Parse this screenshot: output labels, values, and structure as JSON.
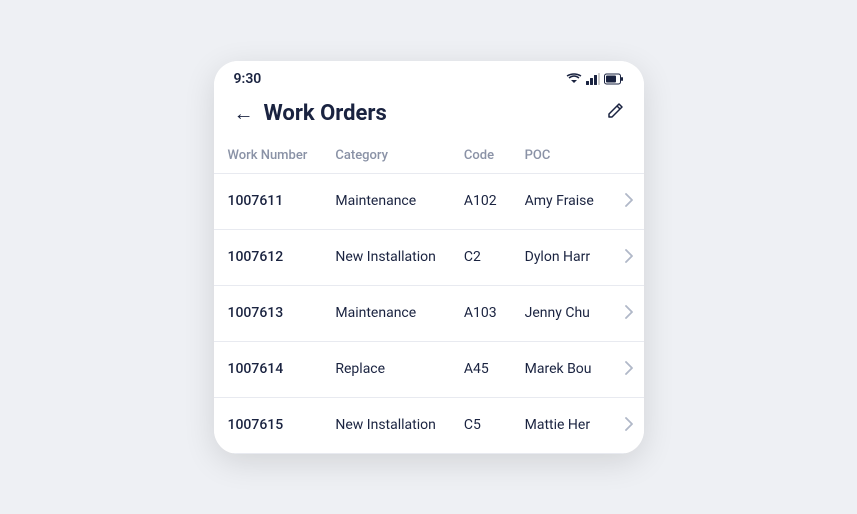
{
  "statusBar": {
    "time": "9:30",
    "wifiIcon": "▼",
    "signalIcon": "▲",
    "batteryIcon": "🔋"
  },
  "header": {
    "title": "Work Orders",
    "backLabel": "←",
    "editLabel": "✎"
  },
  "table": {
    "columns": [
      {
        "label": "Work Number",
        "key": "workNumber"
      },
      {
        "label": "Category",
        "key": "category"
      },
      {
        "label": "Code",
        "key": "code"
      },
      {
        "label": "POC",
        "key": "poc"
      }
    ],
    "rows": [
      {
        "workNumber": "1007611",
        "category": "Maintenance",
        "code": "A102",
        "poc": "Amy Fraise"
      },
      {
        "workNumber": "1007612",
        "category": "New Installation",
        "code": "C2",
        "poc": "Dylon Harr"
      },
      {
        "workNumber": "1007613",
        "category": "Maintenance",
        "code": "A103",
        "poc": "Jenny Chu"
      },
      {
        "workNumber": "1007614",
        "category": "Replace",
        "code": "A45",
        "poc": "Marek Bou"
      },
      {
        "workNumber": "1007615",
        "category": "New Installation",
        "code": "C5",
        "poc": "Mattie Her"
      }
    ]
  }
}
